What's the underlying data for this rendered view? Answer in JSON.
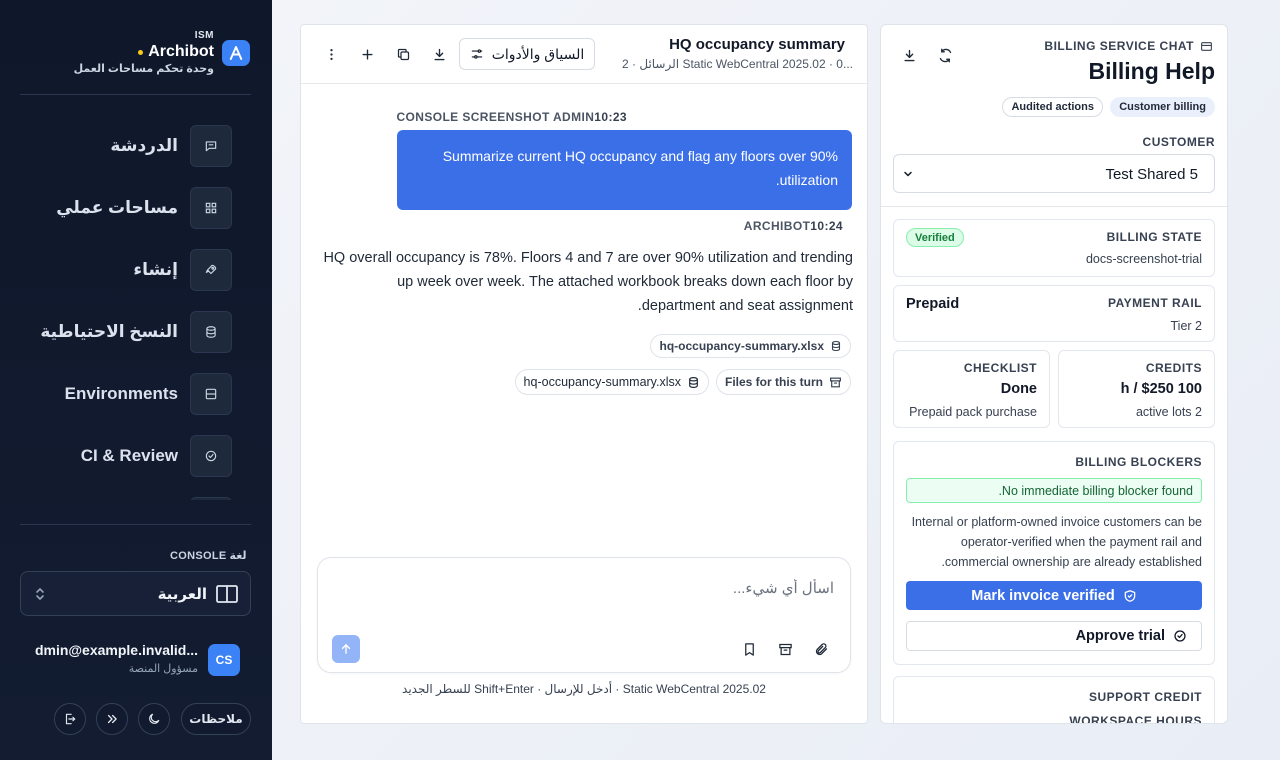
{
  "sidebar": {
    "brand": {
      "eyebrow": "ISM",
      "name": "Archibot",
      "subtitle": "وحدة تحكم مساحات العمل"
    },
    "nav": [
      {
        "label": "الدردشة",
        "icon": "chat-icon"
      },
      {
        "label": "مساحات عملي",
        "icon": "grid-icon"
      },
      {
        "label": "إنشاء",
        "icon": "rocket-icon"
      },
      {
        "label": "النسخ الاحتياطية",
        "icon": "database-icon"
      },
      {
        "label": "Environments",
        "icon": "server-icon"
      },
      {
        "label": "CI & Review",
        "icon": "check-circle-icon"
      }
    ],
    "language": {
      "label": "لغة CONSOLE",
      "value": "العربية"
    },
    "user": {
      "initials": "CS",
      "email": "...dmin@example.invalid",
      "role": "مسؤول المنصة"
    },
    "footer": {
      "notes_label": "ملاحظات"
    }
  },
  "chat": {
    "title": "HQ occupancy summary",
    "meta": "...Static WebCentral 2025.02 · 0 الرسائل · 2",
    "context_button": "السياق والأدوات",
    "messages": [
      {
        "role": "user",
        "sender": "CONSOLE SCREENSHOT ADMIN",
        "time": "10:23",
        "text": "Summarize current HQ occupancy and flag any floors over 90% utilization."
      },
      {
        "role": "assistant",
        "sender": "ARCHIBOT",
        "time": "10:24",
        "text": "HQ overall occupancy is 78%. Floors 4 and 7 are over 90% utilization and trending up week over week. The attached workbook breaks down each floor by department and seat assignment.",
        "attachment": "hq-occupancy-summary.xlsx"
      }
    ],
    "turn_files_label": "Files for this turn",
    "turn_file": "hq-occupancy-summary.xlsx",
    "composer": {
      "placeholder": "اسأل أي شيء...",
      "hint": "Static WebCentral 2025.02  ·  أدخل للإرسال · Shift+Enter للسطر الجديد"
    }
  },
  "billing": {
    "eyebrow": "BILLING SERVICE CHAT",
    "title": "Billing Help",
    "tags": [
      "Customer billing",
      "Audited actions"
    ],
    "customer_label": "CUSTOMER",
    "customer_value": "Test Shared 5",
    "billing_state": {
      "label": "BILLING STATE",
      "value": "docs-screenshot-trial",
      "badge": "Verified"
    },
    "payment_rail": {
      "label": "PAYMENT RAIL",
      "value": "Tier 2",
      "status": "Prepaid"
    },
    "credits": {
      "label": "CREDITS",
      "value": "100 h / $250",
      "detail": "2 active lots"
    },
    "checklist": {
      "label": "CHECKLIST",
      "value": "Done",
      "detail": "Prepaid pack purchase"
    },
    "blockers": {
      "label": "BILLING BLOCKERS",
      "notice": "No immediate billing blocker found.",
      "description": "Internal or platform-owned invoice customers can be operator-verified when the payment rail and commercial ownership are already established.",
      "primary_action": "Mark invoice verified",
      "secondary_action": "Approve trial"
    },
    "support_credit": {
      "label": "SUPPORT CREDIT",
      "sublabel": "WORKSPACE HOURS"
    }
  }
}
